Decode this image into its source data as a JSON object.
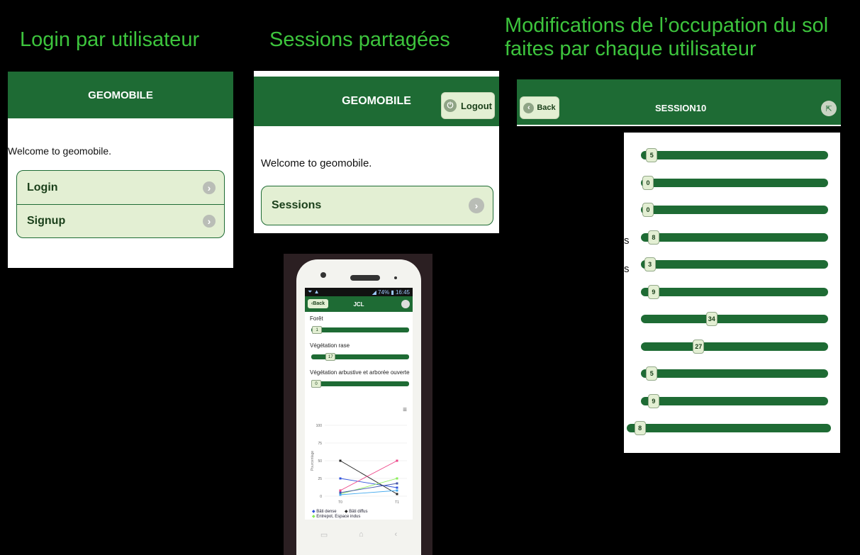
{
  "headings": {
    "login": "Login par utilisateur",
    "sessions": "Sessions partagées",
    "modifications_line1": "Modifications  de l’occupation du sol",
    "modifications_line2": "faites par chaque utilisateur"
  },
  "app_name": "GEOMOBILE",
  "login_screen": {
    "welcome": "Welcome to geomobile.",
    "items": [
      {
        "label": "Login"
      },
      {
        "label": "Signup"
      }
    ]
  },
  "sessions_screen": {
    "logout_label": "Logout",
    "welcome": "Welcome to geomobile.",
    "items": [
      {
        "label": "Sessions"
      }
    ]
  },
  "session_screen": {
    "back_label": "Back",
    "title": "SESSION10",
    "cut_labels": [
      "s",
      "s"
    ],
    "sliders": [
      {
        "value": "5",
        "level": 0.02
      },
      {
        "value": "0",
        "level": 0.0
      },
      {
        "value": "0",
        "level": 0.0
      },
      {
        "value": "8",
        "level": 0.03
      },
      {
        "value": "3",
        "level": 0.01
      },
      {
        "value": "9",
        "level": 0.03
      },
      {
        "value": "34",
        "level": 0.34
      },
      {
        "value": "27",
        "level": 0.27
      },
      {
        "value": "5",
        "level": 0.02
      },
      {
        "value": "9",
        "level": 0.03
      },
      {
        "value": "8",
        "level": 0.03
      }
    ]
  },
  "phone": {
    "status_battery": "74%",
    "status_time": "16:45",
    "back_label": "Back",
    "title": "JCL",
    "sliders": [
      {
        "label": "Forêt",
        "value": "1",
        "level": 0.01
      },
      {
        "label": "Végétation rase",
        "value": "17",
        "level": 0.17
      },
      {
        "label": "Végétation arbustive et arborée ouverte",
        "value": "0",
        "level": 0.0
      }
    ],
    "chart_data": {
      "type": "line",
      "categories": [
        "T0",
        "T1"
      ],
      "ylabel": "Pourcentage",
      "ylim": [
        0,
        100
      ],
      "yticks": [
        "100",
        "75",
        "50",
        "25",
        "0"
      ],
      "series": [
        {
          "name": "Bâti dense",
          "values": [
            25,
            12
          ],
          "color": "#3355dd"
        },
        {
          "name": "Bâti diffus",
          "values": [
            50,
            3
          ],
          "color": "#222222"
        },
        {
          "name": "Entrepot, Espace indus",
          "values": [
            3,
            25
          ],
          "color": "#88ee55"
        },
        {
          "values": [
            8,
            50
          ],
          "color": "#ee4488"
        },
        {
          "values": [
            5,
            18
          ],
          "color": "#4455aa"
        },
        {
          "values": [
            2,
            8
          ],
          "color": "#44aaee"
        }
      ]
    }
  },
  "colors": {
    "heading": "#3dc43d",
    "header_bar": "#1e6b34",
    "list_bg": "#e3efd3"
  }
}
